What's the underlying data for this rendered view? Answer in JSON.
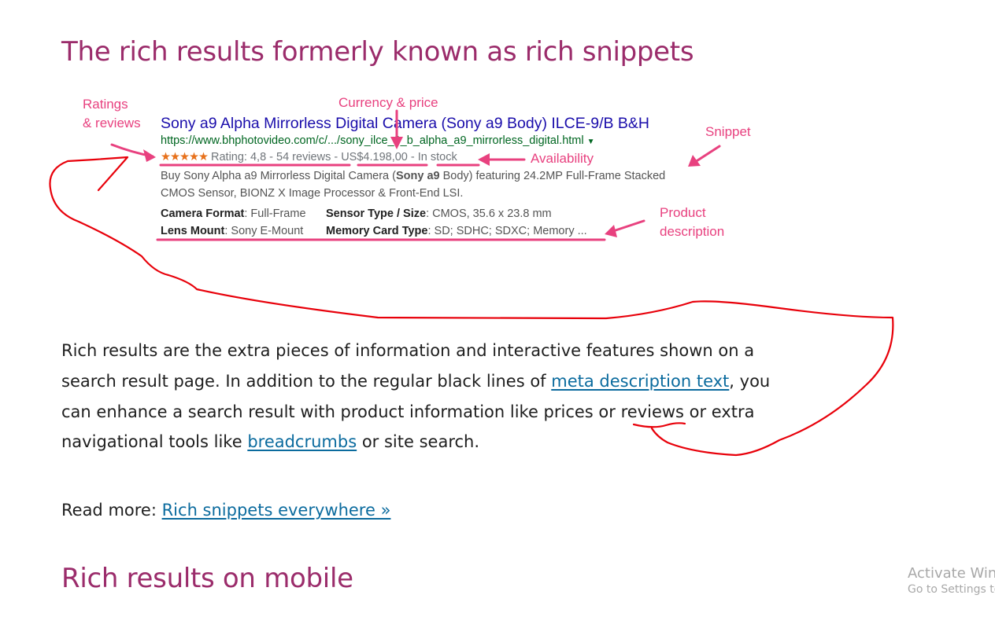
{
  "article": {
    "heading_main": "The rich results formerly known as rich snippets",
    "heading_mobile": "Rich results on mobile",
    "paragraph": {
      "part1": "Rich results are the extra pieces of information and interactive features shown on a search result page. In addition to the regular black lines of ",
      "link1": "meta description text",
      "part2": ", you can enhance a search result with product information like prices or reviews or extra navigational tools like ",
      "link2": "breadcrumbs",
      "part3": " or site search."
    },
    "read_more": {
      "label": "Read more: ",
      "link": "Rich snippets everywhere »"
    }
  },
  "figure": {
    "labels": {
      "ratings_line1": "Ratings",
      "ratings_line2": "& reviews",
      "currency_price": "Currency & price",
      "snippet": "Snippet",
      "availability": "Availability",
      "product_line1": "Product",
      "product_line2": "description"
    },
    "result": {
      "title": "Sony a9 Alpha Mirrorless Digital Camera (Sony a9 Body) ILCE-9/B B&H",
      "url": "https://www.bhphotovideo.com/c/.../sony_ilce_9_b_alpha_a9_mirrorless_digital.html",
      "url_caret": "▼",
      "stars": "★★★★★",
      "rating_text": "Rating: 4,8 - 54 reviews - US$4.198,00 - In stock",
      "desc_line1_a": "Buy Sony Alpha a9 Mirrorless Digital Camera (",
      "desc_line1_bold": "Sony a9",
      "desc_line1_b": " Body) featuring 24.2MP Full-Frame Stacked",
      "desc_line2": "CMOS Sensor, BIONZ X Image Processor & Front-End LSI.",
      "attr_camera_format_label": "Camera Format",
      "attr_camera_format_value": ": Full-Frame",
      "attr_sensor_label": "Sensor Type / Size",
      "attr_sensor_value": ": CMOS, 35.6 x 23.8 mm",
      "attr_lens_label": "Lens Mount",
      "attr_lens_value": ": Sony E-Mount",
      "attr_memory_label": "Memory Card Type",
      "attr_memory_value": ": SD; SDHC; SDXC; Memory ..."
    }
  },
  "watermark": {
    "line1": "Activate Win",
    "line2": "Go to Settings to"
  },
  "colors": {
    "heading": "#9b2c6b",
    "annotation_pink": "#e8417f",
    "freehand_red": "#e8000a",
    "link": "#0b6b9e"
  }
}
